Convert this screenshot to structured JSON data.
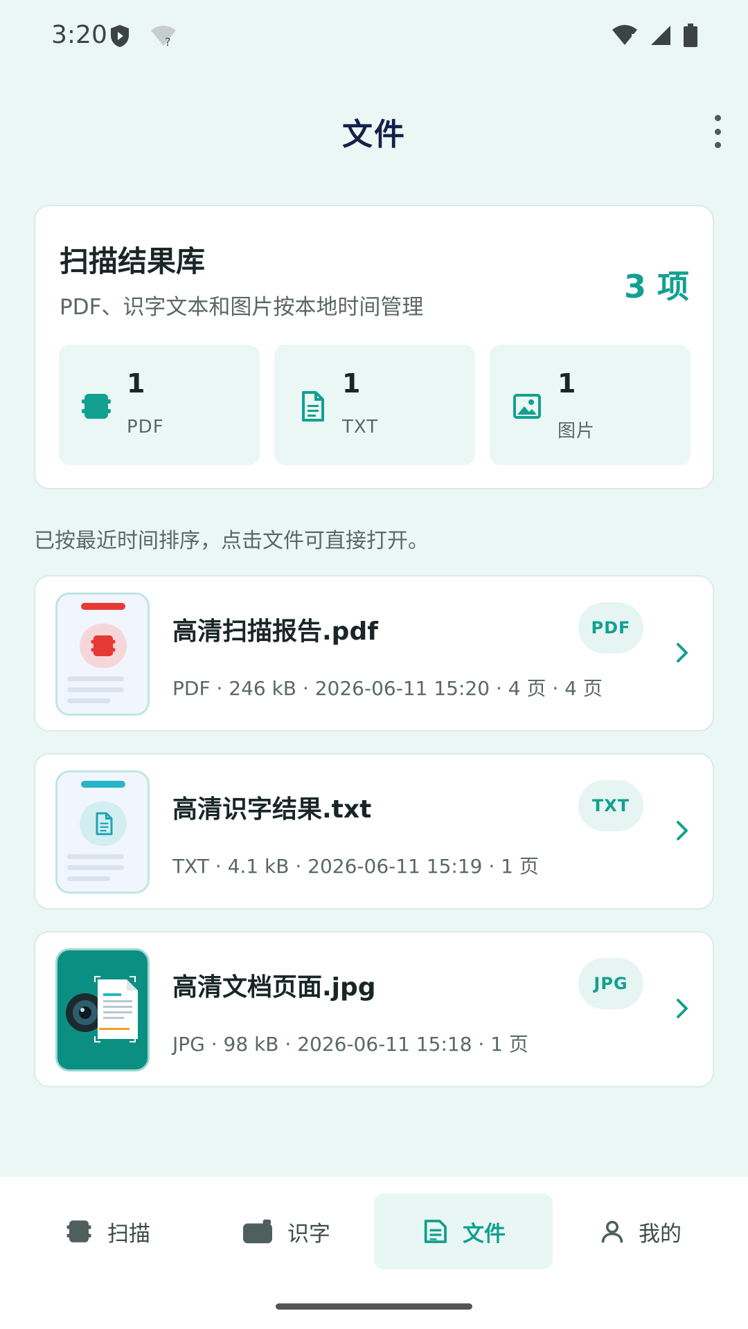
{
  "status_bar": {
    "time": "3:20"
  },
  "app_bar": {
    "title": "文件",
    "more_icon": "more-vert-icon"
  },
  "summary": {
    "title": "扫描结果库",
    "subtitle": "PDF、识字文本和图片按本地时间管理",
    "count": "3 项",
    "stats": [
      {
        "value": "1",
        "label": "PDF",
        "icon": "pdf-icon"
      },
      {
        "value": "1",
        "label": "TXT",
        "icon": "text-doc-icon"
      },
      {
        "value": "1",
        "label": "图片",
        "icon": "image-icon"
      }
    ]
  },
  "sort_hint": "已按最近时间排序，点击文件可直接打开。",
  "files": [
    {
      "name": "高清扫描报告.pdf",
      "meta": "PDF · 246 kB · 2026-06-11 15:20 · 4 页 · 4 页",
      "type": "PDF"
    },
    {
      "name": "高清识字结果.txt",
      "meta": "TXT · 4.1 kB · 2026-06-11 15:19 · 1 页",
      "type": "TXT"
    },
    {
      "name": "高清文档页面.jpg",
      "meta": "JPG · 98 kB · 2026-06-11 15:18 · 1 页",
      "type": "JPG"
    }
  ],
  "nav": [
    {
      "label": "扫描",
      "icon": "scan-icon"
    },
    {
      "label": "识字",
      "icon": "camera-text-icon"
    },
    {
      "label": "文件",
      "icon": "file-icon",
      "active": true
    },
    {
      "label": "我的",
      "icon": "person-icon"
    }
  ],
  "colors": {
    "accent": "#12a090",
    "background": "#eaf7f4",
    "pdf_red": "#e53935",
    "txt_cyan": "#26b6c8"
  }
}
